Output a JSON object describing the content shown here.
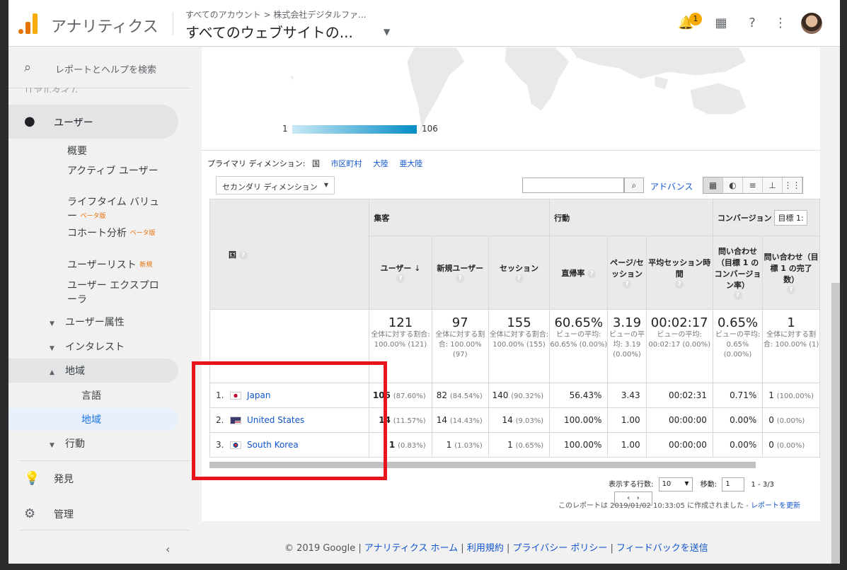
{
  "header": {
    "app_title": "アナリティクス",
    "breadcrumb": "すべてのアカウント > 株式会社デジタルファ...",
    "view_title": "すべてのウェブサイトの...",
    "notification_count": "1"
  },
  "sidebar": {
    "search_placeholder": "レポートとヘルプを検索",
    "cut_item": "リアルタイム",
    "user_section": "ユーザー",
    "sub_items": [
      {
        "label": "概要"
      },
      {
        "label": "アクティブ ユーザー"
      },
      {
        "label": "ライフタイム バリュー",
        "tag": "ベータ版"
      },
      {
        "label": "コホート分析",
        "tag": "ベータ版"
      },
      {
        "label": "ユーザーリスト",
        "tag": "新規"
      },
      {
        "label": "ユーザー エクスプローラ"
      }
    ],
    "groups": [
      "ユーザー属性",
      "インタレスト",
      "地域"
    ],
    "region_children": [
      "言語",
      "地域"
    ],
    "behavior_group": "行動",
    "discover": "発見",
    "admin": "管理"
  },
  "map_legend": {
    "min": "1",
    "max": "106"
  },
  "dimension_bar": {
    "label": "プライマリ ディメンション:",
    "current": "国",
    "options": [
      "市区町村",
      "大陸",
      "亜大陸"
    ]
  },
  "secondary_dimension": "セカンダリ ディメンション",
  "advanced_link": "アドバンス",
  "table": {
    "dimension_header": "国",
    "groups": [
      "集客",
      "行動",
      "コンバージョン"
    ],
    "goal_select": "目標 1:",
    "columns": [
      "ユーザー",
      "新規ユーザー",
      "セッション",
      "直帰率",
      "ページ/セッション",
      "平均セッション時間",
      "問い合わせ（目標 1 のコンバージョン率）",
      "問い合わせ（目標 1 の完了数）"
    ],
    "totals": [
      {
        "value": "121",
        "note": "全体に対する割合: 100.00% (121)"
      },
      {
        "value": "97",
        "note": "全体に対する割合: 100.00% (97)"
      },
      {
        "value": "155",
        "note": "全体に対する割合: 100.00% (155)"
      },
      {
        "value": "60.65%",
        "note": "ビューの平均: 60.65% (0.00%)"
      },
      {
        "value": "3.19",
        "note": "ビューの平均: 3.19 (0.00%)"
      },
      {
        "value": "00:02:17",
        "note": "ビューの平均: 00:02:17 (0.00%)"
      },
      {
        "value": "0.65%",
        "note": "ビューの平均: 0.65% (0.00%)"
      },
      {
        "value": "1",
        "note": "全体に対する割合: 100.00% (1)"
      }
    ],
    "rows": [
      {
        "idx": "1.",
        "country": "Japan",
        "users": "106",
        "users_pct": "(87.60%)",
        "new_users": "82",
        "new_pct": "(84.54%)",
        "sessions": "140",
        "sess_pct": "(90.32%)",
        "bounce": "56.43%",
        "pps": "3.43",
        "avg": "00:02:31",
        "conv": "0.71%",
        "goal": "1",
        "goal_pct": "(100.00%)"
      },
      {
        "idx": "2.",
        "country": "United States",
        "users": "14",
        "users_pct": "(11.57%)",
        "new_users": "14",
        "new_pct": "(14.43%)",
        "sessions": "14",
        "sess_pct": "(9.03%)",
        "bounce": "100.00%",
        "pps": "1.00",
        "avg": "00:00:00",
        "conv": "0.00%",
        "goal": "0",
        "goal_pct": "(0.00%)"
      },
      {
        "idx": "3.",
        "country": "South Korea",
        "users": "1",
        "users_pct": "(0.83%)",
        "new_users": "1",
        "new_pct": "(1.03%)",
        "sessions": "1",
        "sess_pct": "(0.65%)",
        "bounce": "100.00%",
        "pps": "1.00",
        "avg": "00:00:00",
        "conv": "0.00%",
        "goal": "0",
        "goal_pct": "(0.00%)"
      }
    ]
  },
  "pager": {
    "rows_label": "表示する行数:",
    "rows_value": "10",
    "move_label": "移動:",
    "move_value": "1",
    "range": "1 - 3/3"
  },
  "created": {
    "text": "このレポートは 2019/01/02 10:33:05 に作成されました - ",
    "link": "レポートを更新"
  },
  "footer": {
    "copyright": "© 2019 Google | ",
    "links": [
      "アナリティクス ホーム",
      "利用規約",
      "プライバシー ポリシー",
      "フィードバックを送信"
    ]
  }
}
